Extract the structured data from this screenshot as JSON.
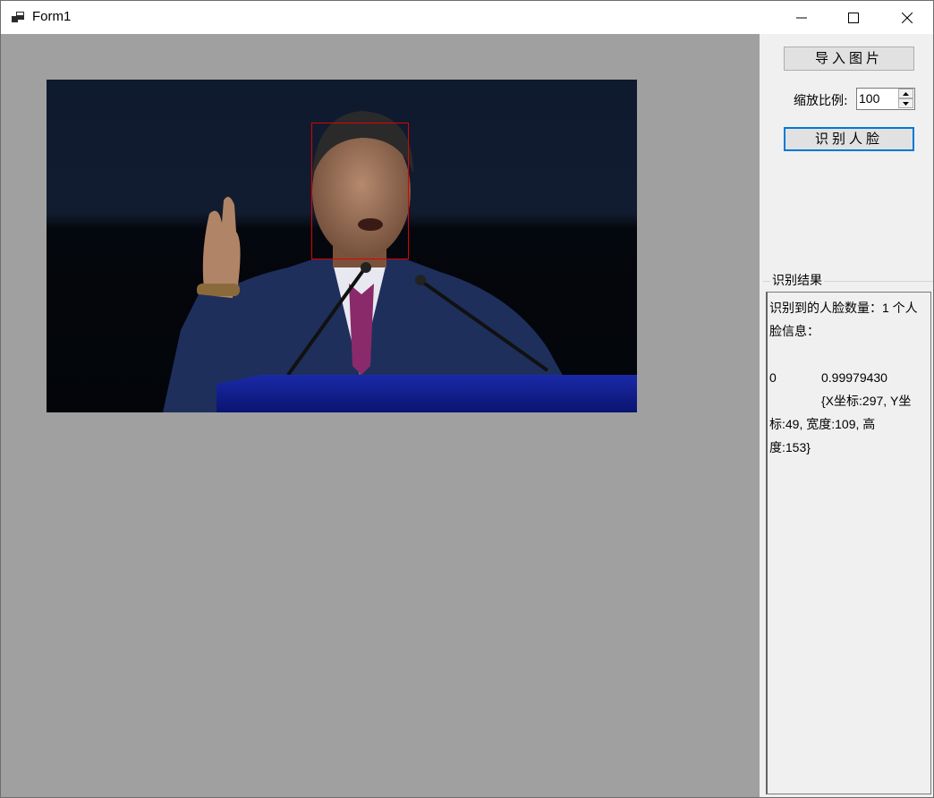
{
  "window": {
    "title": "Form1",
    "controls": {
      "minimize": "minimize-icon",
      "maximize": "maximize-icon",
      "close": "close-icon"
    }
  },
  "picture": {
    "background": "#a0a0a0",
    "image_alt": "speaker photo",
    "face_box_color": "#e00000"
  },
  "controls": {
    "import_button": "导入图片",
    "zoom_label": "缩放比例:",
    "zoom_value": "100",
    "detect_button": "识别人脸"
  },
  "results": {
    "group_title": "识别结果",
    "lines": [
      "识别到的人脸数量：1 个人",
      "脸信息：",
      "",
      "0",
      "0.99979430",
      "{X坐标:297, Y坐",
      "标:49, 宽度:109, 高",
      "度:153}"
    ]
  },
  "colors": {
    "accent": "#0078d7",
    "panel": "#f0f0f0"
  }
}
